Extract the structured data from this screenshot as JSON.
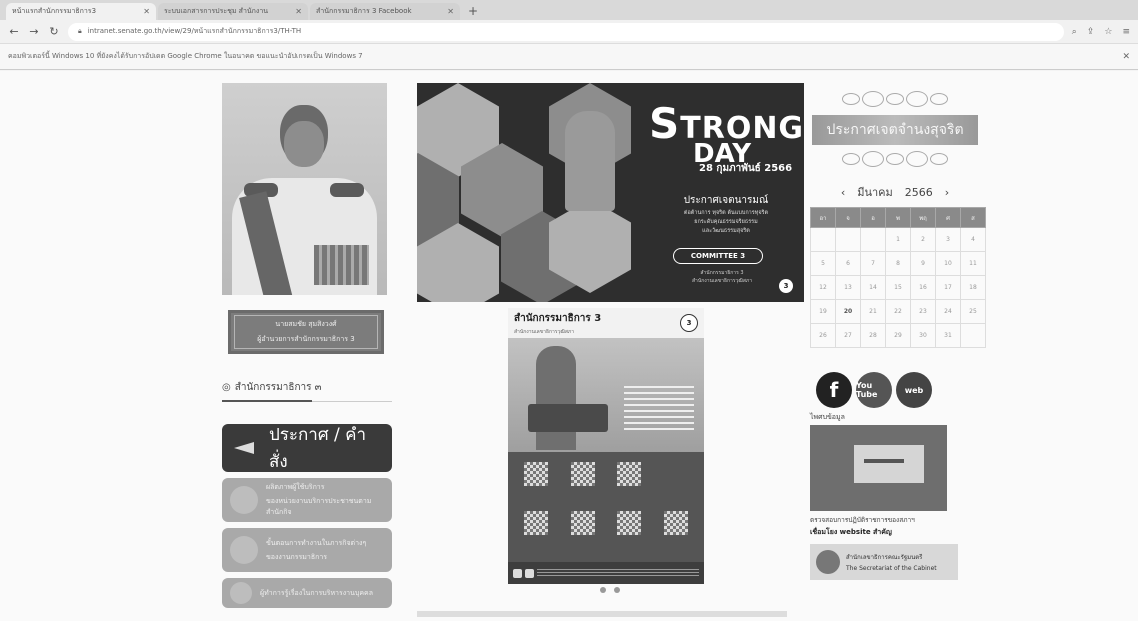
{
  "browser": {
    "tabs": [
      {
        "label": "หน้าแรกสำนักกรรมาธิการ3",
        "active": true
      },
      {
        "label": "ระบบเอกสารการประชุม สำนักงาน",
        "active": false
      },
      {
        "label": "สำนักกรรมาธิการ 3 Facebook",
        "active": false
      }
    ],
    "url": "intranet.senate.go.th/view/29/หน้าแรกสำนักกรรมาธิการ3/TH-TH",
    "infobar": "คอมพิวเตอร์นี้ Windows 10 ที่ยังคงได้รับการอัปเดต Google Chrome ในอนาคต ขอแนะนำอัปเกรดเป็น Windows 7"
  },
  "left": {
    "name_line1": "นายสมชัย สุมสิงวงศ์",
    "name_line2": "ผู้อำนวยการสำนักกรรมาธิการ 3",
    "section": "สำนักกรรมาธิการ ๓",
    "announce": "ประกาศ / คำสั่ง",
    "menu": [
      {
        "l1": "ผลิตภาพผู้ใช้บริการ",
        "l2": "ของหน่วยงานบริการประชาชนตามสำนักกิจ"
      },
      {
        "l1": "ขั้นตอนการทำงานในภารกิจต่างๆ",
        "l2": "ของงานกรรมาธิการ"
      },
      {
        "l1": "ผู้ทำการรู้เรื่องในการบริหารงานบุคคล",
        "l2": ""
      }
    ]
  },
  "banner": {
    "title_big": "S",
    "title_rest": "TRONG",
    "title2": "DAY",
    "date": "28 กุมภาพันธ์ 2566",
    "subtitle": "ประกาศเจตนารมณ์",
    "desc1": "ต่อต้านการ ทุจริต ต้นแบบการทุจริต",
    "desc2": "ยกระดับคุณธรรมจริยธรรม",
    "desc3": "และวัฒนธรรมสุจริต",
    "committee": "COMMITTEE 3",
    "foot1": "สำนักกรรมาธิการ 3",
    "foot2": "สำนักงานเลขาธิการวุฒิสภา",
    "badge": "3"
  },
  "poster": {
    "title": "สำนักกรรมาธิการ 3",
    "subtitle": "สำนักงานเลขาธิการวุฒิสภา",
    "badge": "3"
  },
  "right": {
    "announce": "ประกาศเจตจำนงสุจริต",
    "calendar": {
      "month": "มีนาคม",
      "year": "2566",
      "weekdays": [
        "อา",
        "จ",
        "อ",
        "พ",
        "พฤ",
        "ศ",
        "ส"
      ],
      "weeks": [
        [
          "",
          "",
          "",
          "1",
          "2",
          "3",
          "4"
        ],
        [
          "5",
          "6",
          "7",
          "8",
          "9",
          "10",
          "11"
        ],
        [
          "12",
          "13",
          "14",
          "15",
          "16",
          "17",
          "18"
        ],
        [
          "19",
          "20",
          "21",
          "22",
          "23",
          "24",
          "25"
        ],
        [
          "26",
          "27",
          "28",
          "29",
          "30",
          "31",
          ""
        ]
      ],
      "today": "20"
    },
    "social": {
      "facebook": "f",
      "youtube": "You Tube",
      "web": "web"
    },
    "info_label": "ไพศบข้อมูล",
    "link_caption": "ตรวจสอบการปฏิบัติราชการของสภาฯ",
    "links_label": "เชื่อมโยง website สำคัญ",
    "cabinet_th": "สำนักเลขาธิการคณะรัฐมนตรี",
    "cabinet_en": "The Secretariat of the Cabinet"
  }
}
